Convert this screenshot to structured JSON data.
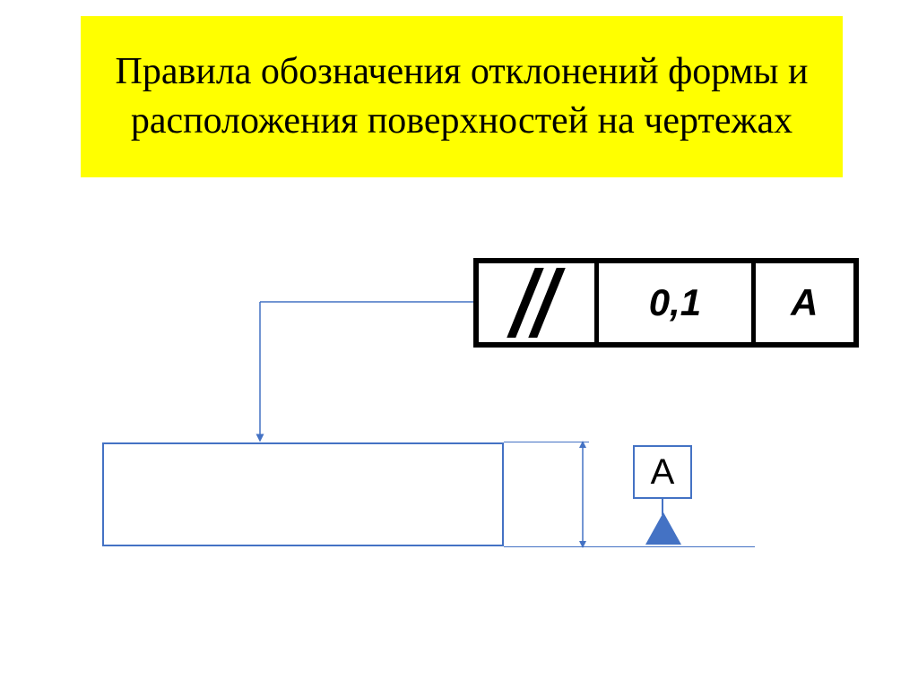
{
  "title": "Правила обозначения отклонений формы и расположения поверхностей на чертежах",
  "tolerance_frame": {
    "symbol": "parallelism",
    "tolerance_value": "0,1",
    "datum_ref": "А"
  },
  "datum": {
    "label": "А"
  },
  "colors": {
    "banner_bg": "#ffff00",
    "line_blue": "#4472c4",
    "black": "#000000"
  }
}
